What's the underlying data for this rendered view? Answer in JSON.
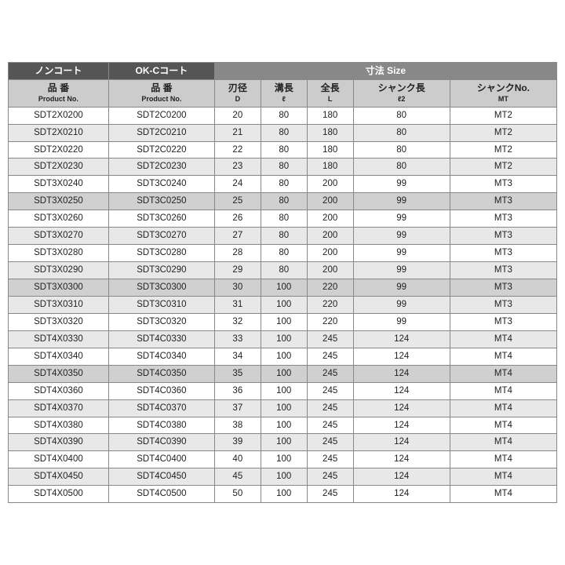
{
  "table": {
    "col_headers_top": [
      {
        "label": "ノンコート",
        "colspan": 1
      },
      {
        "label": "OK-Cコート",
        "colspan": 1
      },
      {
        "label": "寸法 Size",
        "colspan": 5
      }
    ],
    "col_headers_sub": [
      {
        "jp": "品 番",
        "en": "Product No."
      },
      {
        "jp": "品 番",
        "en": "Product No."
      },
      {
        "jp": "刃径",
        "en": "D"
      },
      {
        "jp": "溝長",
        "en": "ℓ"
      },
      {
        "jp": "全長",
        "en": "L"
      },
      {
        "jp": "シャンク長",
        "en": "ℓ2"
      },
      {
        "jp": "シャンクNo.",
        "en": "MT"
      }
    ],
    "rows": [
      {
        "noncoat": "SDT2X0200",
        "okc": "SDT2C0200",
        "d": "20",
        "l": "80",
        "L": "180",
        "l2": "80",
        "mt": "MT2",
        "highlight": false
      },
      {
        "noncoat": "SDT2X0210",
        "okc": "SDT2C0210",
        "d": "21",
        "l": "80",
        "L": "180",
        "l2": "80",
        "mt": "MT2",
        "highlight": false
      },
      {
        "noncoat": "SDT2X0220",
        "okc": "SDT2C0220",
        "d": "22",
        "l": "80",
        "L": "180",
        "l2": "80",
        "mt": "MT2",
        "highlight": false
      },
      {
        "noncoat": "SDT2X0230",
        "okc": "SDT2C0230",
        "d": "23",
        "l": "80",
        "L": "180",
        "l2": "80",
        "mt": "MT2",
        "highlight": false
      },
      {
        "noncoat": "SDT3X0240",
        "okc": "SDT3C0240",
        "d": "24",
        "l": "80",
        "L": "200",
        "l2": "99",
        "mt": "MT3",
        "highlight": false
      },
      {
        "noncoat": "SDT3X0250",
        "okc": "SDT3C0250",
        "d": "25",
        "l": "80",
        "L": "200",
        "l2": "99",
        "mt": "MT3",
        "highlight": true
      },
      {
        "noncoat": "SDT3X0260",
        "okc": "SDT3C0260",
        "d": "26",
        "l": "80",
        "L": "200",
        "l2": "99",
        "mt": "MT3",
        "highlight": false
      },
      {
        "noncoat": "SDT3X0270",
        "okc": "SDT3C0270",
        "d": "27",
        "l": "80",
        "L": "200",
        "l2": "99",
        "mt": "MT3",
        "highlight": false
      },
      {
        "noncoat": "SDT3X0280",
        "okc": "SDT3C0280",
        "d": "28",
        "l": "80",
        "L": "200",
        "l2": "99",
        "mt": "MT3",
        "highlight": false
      },
      {
        "noncoat": "SDT3X0290",
        "okc": "SDT3C0290",
        "d": "29",
        "l": "80",
        "L": "200",
        "l2": "99",
        "mt": "MT3",
        "highlight": false
      },
      {
        "noncoat": "SDT3X0300",
        "okc": "SDT3C0300",
        "d": "30",
        "l": "100",
        "L": "220",
        "l2": "99",
        "mt": "MT3",
        "highlight": true
      },
      {
        "noncoat": "SDT3X0310",
        "okc": "SDT3C0310",
        "d": "31",
        "l": "100",
        "L": "220",
        "l2": "99",
        "mt": "MT3",
        "highlight": false
      },
      {
        "noncoat": "SDT3X0320",
        "okc": "SDT3C0320",
        "d": "32",
        "l": "100",
        "L": "220",
        "l2": "99",
        "mt": "MT3",
        "highlight": false
      },
      {
        "noncoat": "SDT4X0330",
        "okc": "SDT4C0330",
        "d": "33",
        "l": "100",
        "L": "245",
        "l2": "124",
        "mt": "MT4",
        "highlight": false
      },
      {
        "noncoat": "SDT4X0340",
        "okc": "SDT4C0340",
        "d": "34",
        "l": "100",
        "L": "245",
        "l2": "124",
        "mt": "MT4",
        "highlight": false
      },
      {
        "noncoat": "SDT4X0350",
        "okc": "SDT4C0350",
        "d": "35",
        "l": "100",
        "L": "245",
        "l2": "124",
        "mt": "MT4",
        "highlight": true
      },
      {
        "noncoat": "SDT4X0360",
        "okc": "SDT4C0360",
        "d": "36",
        "l": "100",
        "L": "245",
        "l2": "124",
        "mt": "MT4",
        "highlight": false
      },
      {
        "noncoat": "SDT4X0370",
        "okc": "SDT4C0370",
        "d": "37",
        "l": "100",
        "L": "245",
        "l2": "124",
        "mt": "MT4",
        "highlight": false
      },
      {
        "noncoat": "SDT4X0380",
        "okc": "SDT4C0380",
        "d": "38",
        "l": "100",
        "L": "245",
        "l2": "124",
        "mt": "MT4",
        "highlight": false
      },
      {
        "noncoat": "SDT4X0390",
        "okc": "SDT4C0390",
        "d": "39",
        "l": "100",
        "L": "245",
        "l2": "124",
        "mt": "MT4",
        "highlight": false
      },
      {
        "noncoat": "SDT4X0400",
        "okc": "SDT4C0400",
        "d": "40",
        "l": "100",
        "L": "245",
        "l2": "124",
        "mt": "MT4",
        "highlight": false
      },
      {
        "noncoat": "SDT4X0450",
        "okc": "SDT4C0450",
        "d": "45",
        "l": "100",
        "L": "245",
        "l2": "124",
        "mt": "MT4",
        "highlight": false
      },
      {
        "noncoat": "SDT4X0500",
        "okc": "SDT4C0500",
        "d": "50",
        "l": "100",
        "L": "245",
        "l2": "124",
        "mt": "MT4",
        "highlight": false
      }
    ]
  }
}
